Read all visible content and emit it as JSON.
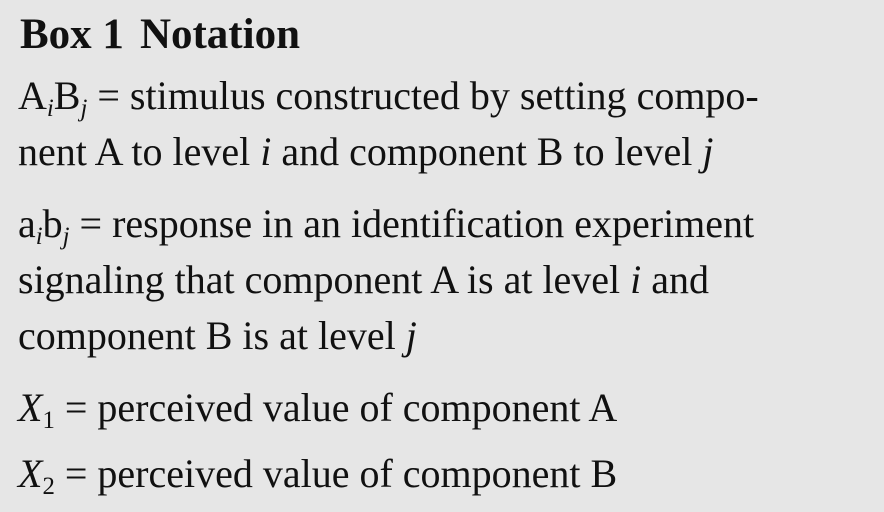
{
  "box": {
    "label": "Box 1",
    "heading": "Notation"
  },
  "entries": [
    {
      "term": {
        "main1": "A",
        "sub1": "i",
        "main2": "B",
        "sub2": "j"
      },
      "equals": "=",
      "line1_words": [
        "stimulus",
        "constructed",
        "by",
        "setting",
        "compo-"
      ],
      "line2": {
        "t1": "nent A to level ",
        "v1": "i",
        "t2": " and component B to level ",
        "v2": "j"
      }
    },
    {
      "term": {
        "main1": "a",
        "sub1": "i",
        "main2": "b",
        "sub2": "j"
      },
      "equals": "=",
      "line1_words": [
        "response",
        "in",
        "an",
        "identification",
        "experiment"
      ],
      "line2_words": [
        "signaling",
        "that",
        "component",
        "A",
        "is",
        "at",
        "level",
        "i",
        "and"
      ],
      "line3": {
        "t1": "component B is at level ",
        "v1": "j"
      }
    },
    {
      "term": {
        "var": "X",
        "sub": "1"
      },
      "equals": "=",
      "text": "perceived value of component A"
    },
    {
      "term": {
        "var": "X",
        "sub": "2"
      },
      "equals": "=",
      "text": "perceived value of component B"
    }
  ]
}
